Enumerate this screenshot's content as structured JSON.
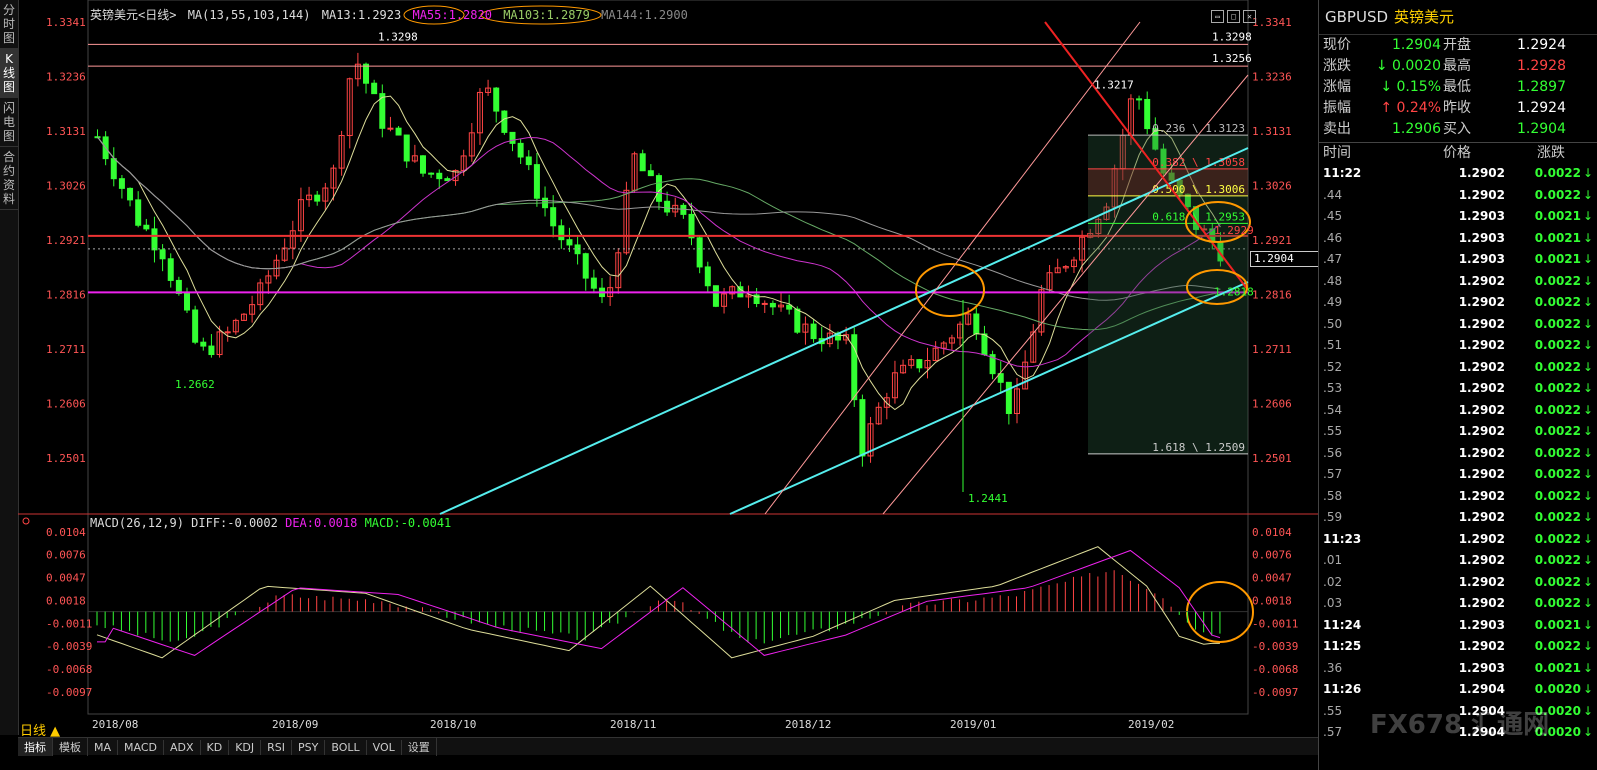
{
  "window": {
    "title": "英镑美元<日线>"
  },
  "left_tabs": [
    "分时图",
    "K线图",
    "闪电图",
    "合约资料"
  ],
  "legend": {
    "ma_label": "MA(13,55,103,144)",
    "ma13": "MA13:1.2923",
    "ma55": "MA55:1.2820",
    "ma103": "MA103:1.2879",
    "ma144": "MA144:1.2900"
  },
  "macd_legend": {
    "label": "MACD(26,12,9)",
    "diff": "DIFF:-0.0002",
    "dea": "DEA:0.0018",
    "macd": "MACD:-0.0041"
  },
  "price_axis": [
    "1.3341",
    "1.3236",
    "1.3131",
    "1.3026",
    "1.2921",
    "1.2816",
    "1.2711",
    "1.2606",
    "1.2501"
  ],
  "macd_axis": [
    "0.0104",
    "0.0076",
    "0.0047",
    "0.0018",
    "-0.0011",
    "-0.0039",
    "-0.0068",
    "-0.0097"
  ],
  "date_axis": [
    "2018/08",
    "2018/09",
    "2018/10",
    "2018/11",
    "2018/12",
    "2019/01",
    "2019/02"
  ],
  "annotations": {
    "high": "1.3298",
    "high_line_right": "1.3298",
    "line_1_3256": "1.3256",
    "peak_jan": "1.3217",
    "low_aug": "1.2662",
    "low_jan": "1.2441",
    "fib_0236": "0.236 \\ 1.3123",
    "fib_0382": "0.382 \\ 1.3058",
    "fib_0500": "0.500 \\ 1.3006",
    "fib_0618": "0.618 \\ 1.2953",
    "fib_1618": "1.618 \\ 1.2509",
    "label_2929": "1.2929",
    "label_2818": "1.2818",
    "current_price": "1.2904"
  },
  "period_button": "日线 ▲",
  "bottom_tabs": [
    "指标",
    "模板",
    "MA",
    "MACD",
    "ADX",
    "KD",
    "KDJ",
    "RSI",
    "PSY",
    "BOLL",
    "VOL",
    "设置"
  ],
  "quote": {
    "symbol": "GBPUSD",
    "name": "英镑美元",
    "rows": [
      {
        "l1": "现价",
        "v1": "1.2904",
        "c1": "#3f3",
        "l2": "开盘",
        "v2": "1.2924",
        "c2": "#fff"
      },
      {
        "l1": "涨跌",
        "v1": "↓ 0.0020",
        "c1": "#3f3",
        "l2": "最高",
        "v2": "1.2928",
        "c2": "#f44"
      },
      {
        "l1": "涨幅",
        "v1": "↓ 0.15%",
        "c1": "#3f3",
        "l2": "最低",
        "v2": "1.2897",
        "c2": "#3f3"
      },
      {
        "l1": "振幅",
        "v1": "↑ 0.24%",
        "c1": "#f44",
        "l2": "昨收",
        "v2": "1.2924",
        "c2": "#fff"
      },
      {
        "l1": "卖出",
        "v1": "1.2906",
        "c1": "#3f3",
        "l2": "买入",
        "v2": "1.2904",
        "c2": "#3f3"
      }
    ],
    "tick_headers": {
      "time": "时间",
      "price": "价格",
      "change": "涨跌"
    }
  },
  "ticks": [
    {
      "t": "11:22",
      "full": true,
      "p": "1.2902",
      "c": "0.0022"
    },
    {
      "t": ".44",
      "full": false,
      "p": "1.2902",
      "c": "0.0022"
    },
    {
      "t": ".45",
      "full": false,
      "p": "1.2903",
      "c": "0.0021"
    },
    {
      "t": ".46",
      "full": false,
      "p": "1.2903",
      "c": "0.0021"
    },
    {
      "t": ".47",
      "full": false,
      "p": "1.2903",
      "c": "0.0021"
    },
    {
      "t": ".48",
      "full": false,
      "p": "1.2902",
      "c": "0.0022"
    },
    {
      "t": ".49",
      "full": false,
      "p": "1.2902",
      "c": "0.0022"
    },
    {
      "t": ".50",
      "full": false,
      "p": "1.2902",
      "c": "0.0022"
    },
    {
      "t": ".51",
      "full": false,
      "p": "1.2902",
      "c": "0.0022"
    },
    {
      "t": ".52",
      "full": false,
      "p": "1.2902",
      "c": "0.0022"
    },
    {
      "t": ".53",
      "full": false,
      "p": "1.2902",
      "c": "0.0022"
    },
    {
      "t": ".54",
      "full": false,
      "p": "1.2902",
      "c": "0.0022"
    },
    {
      "t": ".55",
      "full": false,
      "p": "1.2902",
      "c": "0.0022"
    },
    {
      "t": ".56",
      "full": false,
      "p": "1.2902",
      "c": "0.0022"
    },
    {
      "t": ".57",
      "full": false,
      "p": "1.2902",
      "c": "0.0022"
    },
    {
      "t": ".58",
      "full": false,
      "p": "1.2902",
      "c": "0.0022"
    },
    {
      "t": ".59",
      "full": false,
      "p": "1.2902",
      "c": "0.0022"
    },
    {
      "t": "11:23",
      "full": true,
      "p": "1.2902",
      "c": "0.0022"
    },
    {
      "t": ".01",
      "full": false,
      "p": "1.2902",
      "c": "0.0022"
    },
    {
      "t": ".02",
      "full": false,
      "p": "1.2902",
      "c": "0.0022"
    },
    {
      "t": ".03",
      "full": false,
      "p": "1.2902",
      "c": "0.0022"
    },
    {
      "t": "11:24",
      "full": true,
      "p": "1.2903",
      "c": "0.0021"
    },
    {
      "t": "11:25",
      "full": true,
      "p": "1.2902",
      "c": "0.0022"
    },
    {
      "t": ".36",
      "full": false,
      "p": "1.2903",
      "c": "0.0021"
    },
    {
      "t": "11:26",
      "full": true,
      "p": "1.2904",
      "c": "0.0020"
    },
    {
      "t": ".55",
      "full": false,
      "p": "1.2904",
      "c": "0.0020"
    },
    {
      "t": ".57",
      "full": false,
      "p": "1.2904",
      "c": "0.0020"
    }
  ],
  "watermark": "FX678 汇通网",
  "colors": {
    "up": "#f44",
    "down": "#3f3",
    "cyan": "#5ee",
    "magenta": "#e2e",
    "salmon": "#f99",
    "orange": "#f90"
  }
}
